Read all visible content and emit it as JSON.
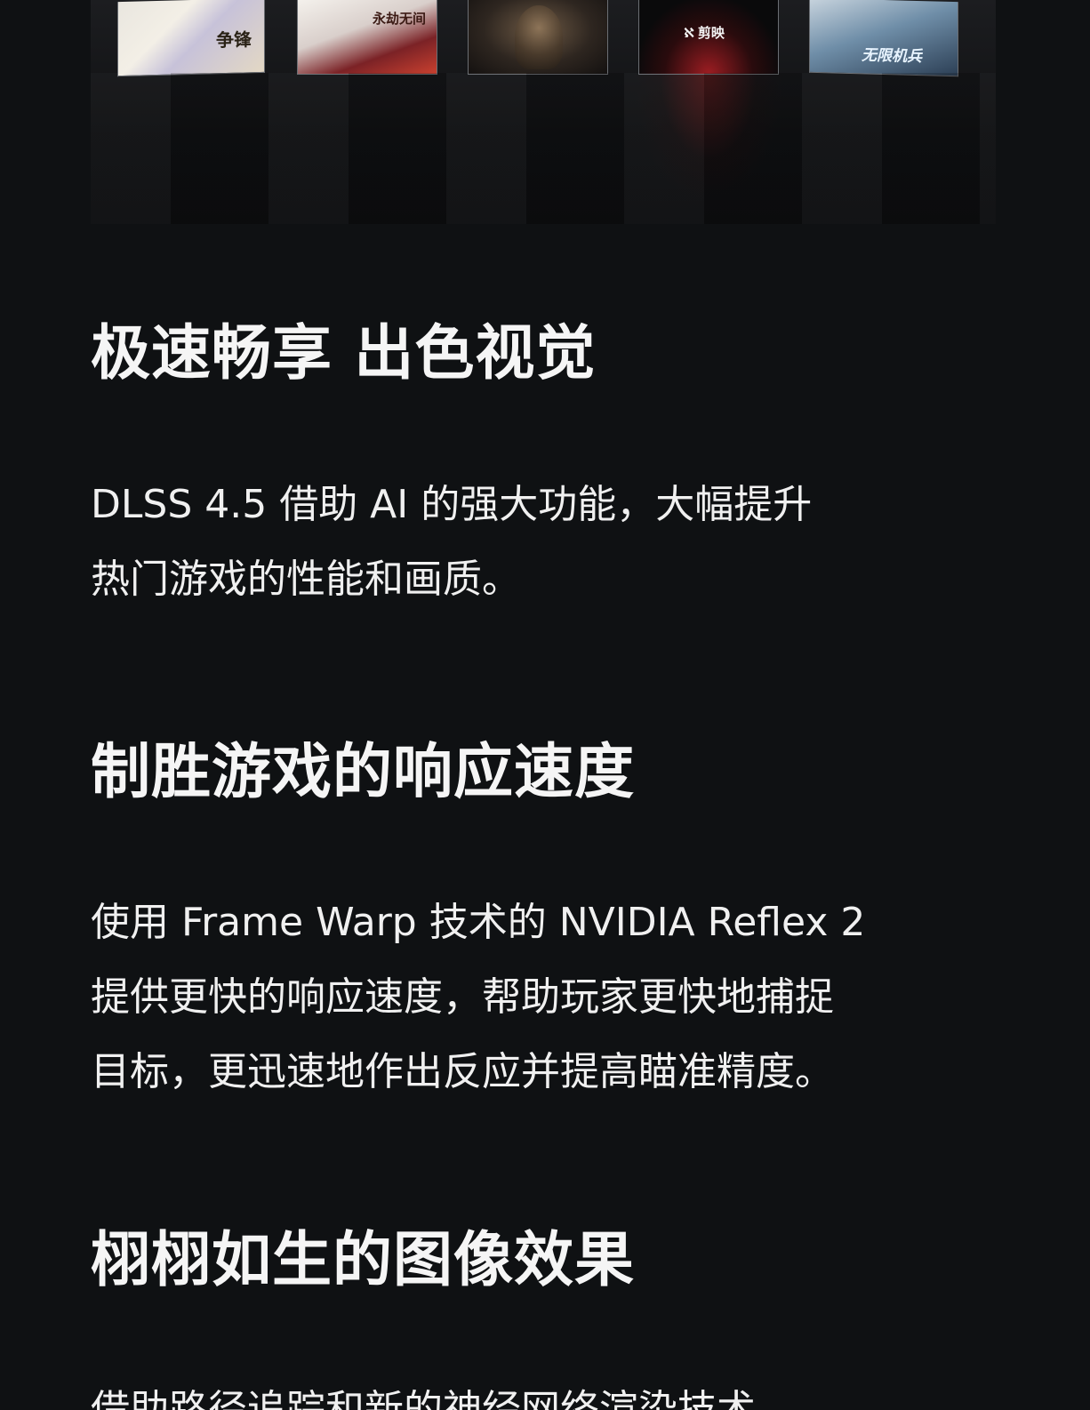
{
  "hero": {
    "tiles": [
      {
        "name": "game-tile-1",
        "label": "争锋"
      },
      {
        "name": "game-tile-2",
        "label": "永劫无间"
      },
      {
        "name": "game-tile-3",
        "label": ""
      },
      {
        "name": "game-tile-4",
        "label": "剪映"
      },
      {
        "name": "game-tile-5",
        "label": "无限机兵"
      }
    ]
  },
  "sections": [
    {
      "heading": "极速畅享 出色视觉",
      "body": [
        "DLSS 4.5 借助 AI 的强大功能，大幅提升",
        "热门游戏的性能和画质。"
      ]
    },
    {
      "heading": "制胜游戏的响应速度",
      "body": [
        "使用 Frame Warp 技术的 NVIDIA Reflex 2",
        "提供更快的响应速度，帮助玩家更快地捕捉",
        "目标，更迅速地作出反应并提高瞄准精度。"
      ]
    },
    {
      "heading": "栩栩如生的图像效果",
      "body": [
        "借助路径追踪和新的神经网络渲染技术"
      ]
    }
  ]
}
